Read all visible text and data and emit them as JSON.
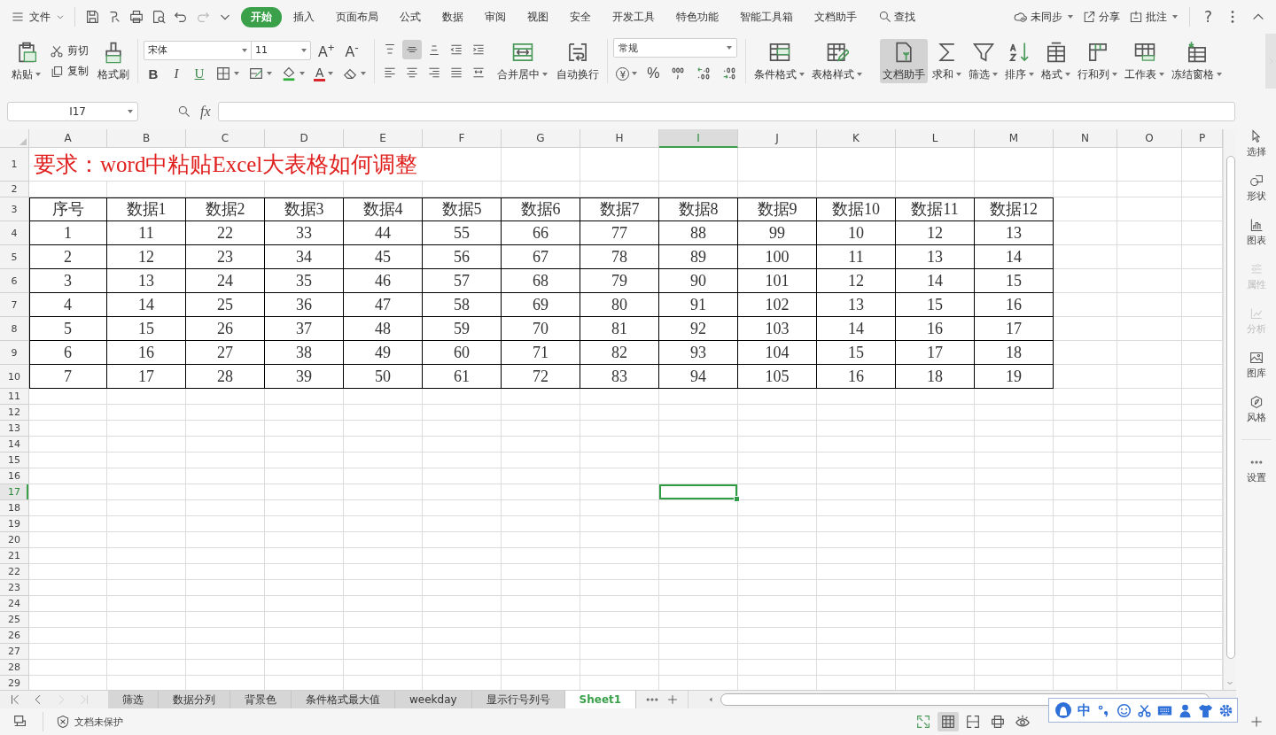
{
  "topbar": {
    "file_menu": "文件",
    "tabs": [
      {
        "label": "开始",
        "selected": true
      },
      {
        "label": "插入",
        "selected": false
      },
      {
        "label": "页面布局",
        "selected": false
      },
      {
        "label": "公式",
        "selected": false
      },
      {
        "label": "数据",
        "selected": false
      },
      {
        "label": "审阅",
        "selected": false
      },
      {
        "label": "视图",
        "selected": false
      },
      {
        "label": "安全",
        "selected": false
      },
      {
        "label": "开发工具",
        "selected": false
      },
      {
        "label": "特色功能",
        "selected": false
      },
      {
        "label": "智能工具箱",
        "selected": false
      },
      {
        "label": "文档助手",
        "selected": false
      }
    ],
    "search": "查找",
    "actions": [
      {
        "label": "未同步",
        "dropdown": true
      },
      {
        "label": "分享",
        "dropdown": false
      },
      {
        "label": "批注",
        "dropdown": true
      }
    ],
    "help": "?"
  },
  "ribbon": {
    "clipboard": {
      "paste": "粘贴",
      "cut": "剪切",
      "copy": "复制",
      "format_painter": "格式刷"
    },
    "font": {
      "name": "宋体",
      "size": "11",
      "grow": "A$^{+}$",
      "shrink": "A$^{-}$",
      "bold": "B",
      "italic": "I",
      "underline": "U",
      "font_color": "A"
    },
    "align_buttons": [
      {
        "selected": false
      },
      {
        "selected": true
      },
      {
        "selected": false
      },
      {
        "selected": false
      },
      {
        "selected": false
      },
      {
        "selected": false
      },
      {
        "selected": false
      },
      {
        "selected": false
      },
      {
        "selected": false
      },
      {
        "selected": false
      }
    ],
    "merge": "合并居中",
    "wrap": "自动换行",
    "number": {
      "format": "常规",
      "currency": "¥",
      "percent": "%"
    },
    "tools": [
      {
        "label": "条件格式",
        "dropdown": true,
        "selected": false
      },
      {
        "label": "表格样式",
        "dropdown": true,
        "selected": false
      },
      {
        "label": "文档助手",
        "dropdown": false,
        "selected": true
      },
      {
        "label": "求和",
        "dropdown": true,
        "selected": false
      },
      {
        "label": "筛选",
        "dropdown": true,
        "selected": false
      },
      {
        "label": "排序",
        "dropdown": true,
        "selected": false
      },
      {
        "label": "格式",
        "dropdown": true,
        "selected": false
      },
      {
        "label": "行和列",
        "dropdown": true,
        "selected": false
      },
      {
        "label": "工作表",
        "dropdown": true,
        "selected": false
      },
      {
        "label": "冻结窗格",
        "dropdown": true,
        "selected": false
      }
    ]
  },
  "formula_bar": {
    "name_box": "I17",
    "fx": "fx"
  },
  "sheet": {
    "columns": [
      {
        "label": "A",
        "selected": false
      },
      {
        "label": "B",
        "selected": false
      },
      {
        "label": "C",
        "selected": false
      },
      {
        "label": "D",
        "selected": false
      },
      {
        "label": "E",
        "selected": false
      },
      {
        "label": "F",
        "selected": false
      },
      {
        "label": "G",
        "selected": false
      },
      {
        "label": "H",
        "selected": false
      },
      {
        "label": "I",
        "selected": true
      },
      {
        "label": "J",
        "selected": false
      },
      {
        "label": "K",
        "selected": false
      },
      {
        "label": "L",
        "selected": false
      },
      {
        "label": "M",
        "selected": false
      },
      {
        "label": "N",
        "selected": false
      },
      {
        "label": "O",
        "selected": false
      },
      {
        "label": "P",
        "selected": false
      }
    ],
    "rows": [
      {
        "label": "1",
        "selected": false,
        "kind": "title",
        "text": "要求：word中粘贴Excel大表格如何调整"
      },
      {
        "label": "2",
        "selected": false,
        "kind": "blank"
      },
      {
        "label": "3",
        "selected": false,
        "kind": "header",
        "cells": [
          "序号",
          "数据1",
          "数据2",
          "数据3",
          "数据4",
          "数据5",
          "数据6",
          "数据7",
          "数据8",
          "数据9",
          "数据10",
          "数据11",
          "数据12"
        ]
      },
      {
        "label": "4",
        "selected": false,
        "kind": "data",
        "cells": [
          "1",
          "11",
          "22",
          "33",
          "44",
          "55",
          "66",
          "77",
          "88",
          "99",
          "10",
          "12",
          "13"
        ]
      },
      {
        "label": "5",
        "selected": false,
        "kind": "data",
        "cells": [
          "2",
          "12",
          "23",
          "34",
          "45",
          "56",
          "67",
          "78",
          "89",
          "100",
          "11",
          "13",
          "14"
        ]
      },
      {
        "label": "6",
        "selected": false,
        "kind": "data",
        "cells": [
          "3",
          "13",
          "24",
          "35",
          "46",
          "57",
          "68",
          "79",
          "90",
          "101",
          "12",
          "14",
          "15"
        ]
      },
      {
        "label": "7",
        "selected": false,
        "kind": "data",
        "cells": [
          "4",
          "14",
          "25",
          "36",
          "47",
          "58",
          "69",
          "80",
          "91",
          "102",
          "13",
          "15",
          "16"
        ]
      },
      {
        "label": "8",
        "selected": false,
        "kind": "data",
        "cells": [
          "5",
          "15",
          "26",
          "37",
          "48",
          "59",
          "70",
          "81",
          "92",
          "103",
          "14",
          "16",
          "17"
        ]
      },
      {
        "label": "9",
        "selected": false,
        "kind": "data",
        "cells": [
          "6",
          "16",
          "27",
          "38",
          "49",
          "60",
          "71",
          "82",
          "93",
          "104",
          "15",
          "17",
          "18"
        ]
      },
      {
        "label": "10",
        "selected": false,
        "kind": "data",
        "cells": [
          "7",
          "17",
          "28",
          "39",
          "50",
          "61",
          "72",
          "83",
          "94",
          "105",
          "16",
          "18",
          "19"
        ]
      },
      {
        "label": "11",
        "selected": false,
        "kind": "blank"
      },
      {
        "label": "12",
        "selected": false,
        "kind": "blank"
      },
      {
        "label": "13",
        "selected": false,
        "kind": "blank"
      },
      {
        "label": "14",
        "selected": false,
        "kind": "blank"
      },
      {
        "label": "15",
        "selected": false,
        "kind": "blank"
      },
      {
        "label": "16",
        "selected": false,
        "kind": "blank"
      },
      {
        "label": "17",
        "selected": true,
        "kind": "blank"
      },
      {
        "label": "18",
        "selected": false,
        "kind": "blank"
      },
      {
        "label": "19",
        "selected": false,
        "kind": "blank"
      },
      {
        "label": "20",
        "selected": false,
        "kind": "blank"
      },
      {
        "label": "21",
        "selected": false,
        "kind": "blank"
      },
      {
        "label": "22",
        "selected": false,
        "kind": "blank"
      },
      {
        "label": "23",
        "selected": false,
        "kind": "blank"
      },
      {
        "label": "24",
        "selected": false,
        "kind": "blank"
      },
      {
        "label": "25",
        "selected": false,
        "kind": "blank"
      },
      {
        "label": "26",
        "selected": false,
        "kind": "blank"
      },
      {
        "label": "27",
        "selected": false,
        "kind": "blank"
      },
      {
        "label": "28",
        "selected": false,
        "kind": "blank"
      },
      {
        "label": "29",
        "selected": false,
        "kind": "blank"
      }
    ]
  },
  "sheet_tabs": [
    {
      "label": "筛选",
      "selected": false
    },
    {
      "label": "数据分列",
      "selected": false
    },
    {
      "label": "背景色",
      "selected": false
    },
    {
      "label": "条件格式最大值",
      "selected": false
    },
    {
      "label": "weekday",
      "selected": false
    },
    {
      "label": "显示行号列号",
      "selected": false
    },
    {
      "label": "Sheet1",
      "selected": true
    }
  ],
  "side_panel": [
    {
      "label": "选择",
      "disabled": false
    },
    {
      "label": "形状",
      "disabled": false
    },
    {
      "label": "图表",
      "disabled": false
    },
    {
      "label": "属性",
      "disabled": true
    },
    {
      "label": "分析",
      "disabled": true
    },
    {
      "label": "图库",
      "disabled": false
    },
    {
      "label": "风格",
      "disabled": false
    },
    {
      "label": "设置",
      "disabled": false
    }
  ],
  "status_bar": {
    "protection": "文档未保护",
    "views": [
      {
        "selected": false
      },
      {
        "selected": true
      },
      {
        "selected": false
      },
      {
        "selected": false
      },
      {
        "selected": false
      }
    ]
  },
  "ime_toolbar": {
    "mode": "中"
  }
}
